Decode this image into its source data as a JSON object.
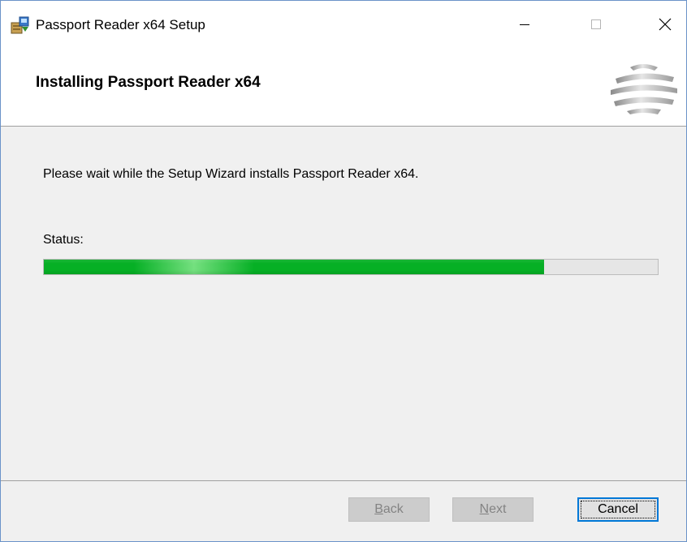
{
  "window": {
    "title": "Passport Reader x64 Setup",
    "icons": {
      "app": "installer-package-icon",
      "minimize": "minimize-icon",
      "maximize": "maximize-icon",
      "close": "close-icon"
    }
  },
  "header": {
    "title": "Installing Passport Reader x64",
    "logo": "striped-sphere-logo"
  },
  "main": {
    "message": "Please wait while the Setup Wizard installs Passport Reader x64.",
    "status_label": "Status:",
    "progress": 0.815
  },
  "footer": {
    "back": {
      "accel": "B",
      "rest": "ack",
      "enabled": false
    },
    "next": {
      "accel": "N",
      "rest": "ext",
      "enabled": false
    },
    "cancel": {
      "label": "Cancel",
      "enabled": true,
      "focused": true
    }
  },
  "colors": {
    "progress_fill": "#06b025",
    "progress_highlight": "#74e07f",
    "focus_border": "#0078d7",
    "window_border": "#6b93c9",
    "panel_bg": "#f0f0f0"
  }
}
